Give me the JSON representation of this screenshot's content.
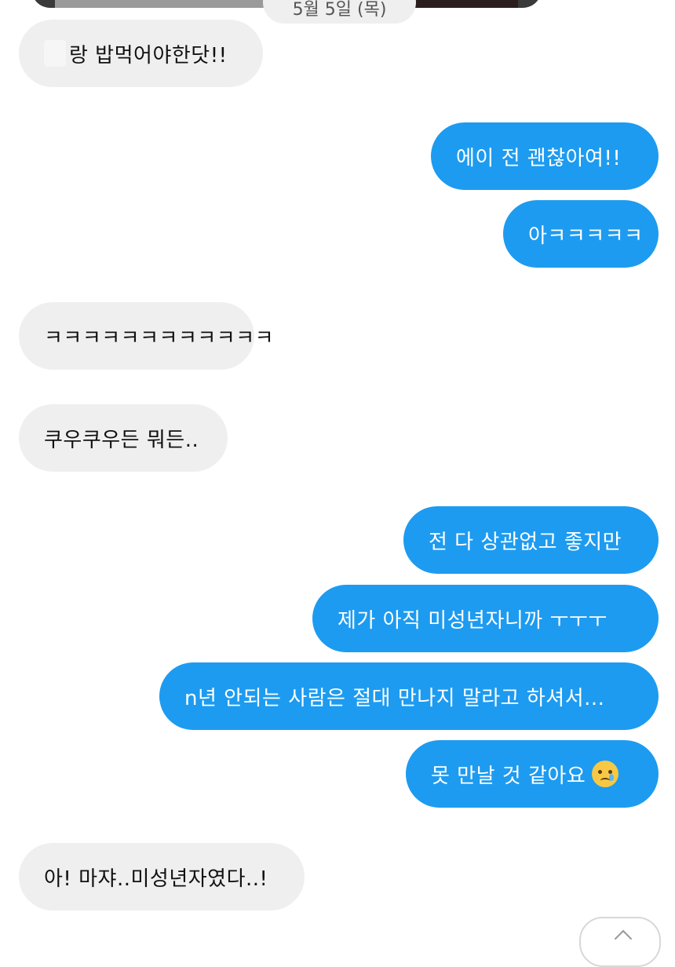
{
  "header": {
    "date_label": "5월 5일 (목)"
  },
  "messages": [
    {
      "side": "in",
      "text": "랑 밥먹어야한닷!!",
      "redacted_prefix": true
    },
    {
      "side": "out",
      "text": "에이 전 괜찮아여!!"
    },
    {
      "side": "out",
      "text": "아ㅋㅋㅋㅋㅋ"
    },
    {
      "side": "in",
      "text": "ㅋㅋㅋㅋㅋㅋㅋㅋㅋㅋㅋㅋ"
    },
    {
      "side": "in",
      "text": "쿠우쿠우든 뭐든.."
    },
    {
      "side": "out",
      "text": "전 다 상관없고 좋지만"
    },
    {
      "side": "out",
      "text": "제가 아직 미성년자니까 ㅜㅜㅜ"
    },
    {
      "side": "out",
      "text": "n년 안되는 사람은 절대 만나지 말라고 하셔서..."
    },
    {
      "side": "out",
      "text": "못 만날 것 같아요",
      "emoji": "crying-face-emoji"
    },
    {
      "side": "in",
      "text": "아! 마쟈..미성년자였다..!"
    }
  ],
  "colors": {
    "outgoing_bubble": "#1d9bf0",
    "incoming_bubble": "#efefef"
  },
  "icons": {
    "scroll_button": "chevron-up-icon"
  }
}
